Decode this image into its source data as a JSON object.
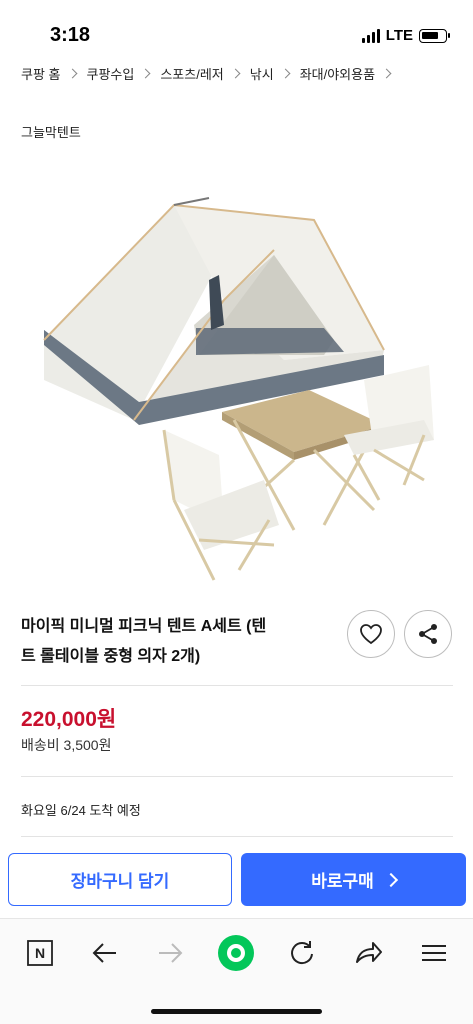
{
  "status": {
    "time": "3:18",
    "network": "LTE"
  },
  "breadcrumb": [
    "쿠팡 홈",
    "쿠팡수입",
    "스포츠/레저",
    "낚시",
    "좌대/야외용품"
  ],
  "brand": "그늘막텐트",
  "product": {
    "title": "마이픽 미니멀 피크닉 텐트 A세트 (텐트 롤테이블 중형 의자 2개)",
    "title_line1": "마이픽 미니멀 피크닉 텐트 A세트 (텐",
    "title_line2": "트 롤테이블 중형 의자 2개)",
    "price": "220,000원",
    "shipping": "배송비 3,500원",
    "delivery": "화요일 6/24 도착 예정"
  },
  "actions": {
    "cart_label": "장바구니 담기",
    "buy_label": "바로구매"
  },
  "colors": {
    "price": "#c8102e",
    "accent": "#346aff",
    "naver_green": "#03c75a"
  },
  "toolbar": {
    "icons": [
      "naver-n-icon",
      "back-arrow-icon",
      "forward-arrow-icon",
      "green-dot-icon",
      "reload-icon",
      "share-arrow-icon",
      "menu-icon"
    ],
    "naver_label": "N"
  }
}
